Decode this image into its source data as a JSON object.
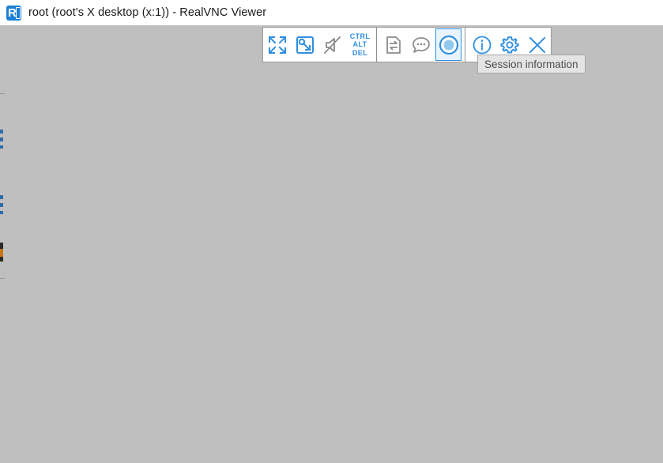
{
  "window": {
    "title": "root (root's X desktop (x:1)) - RealVNC Viewer",
    "app_icon": "realvnc-logo-icon",
    "titlebar_background": "#ffffff",
    "title_color": "#1a1a1a"
  },
  "desktop": {
    "background_color": "#bfbfbf",
    "description": "remote desktop canvas"
  },
  "toolbar": {
    "background": "#ffffff",
    "border_color": "#9b9b9b",
    "accent_color": "#2f8fe0",
    "disabled_color": "#8c8c8c",
    "active_highlight_background": "#eaf4fc",
    "buttons": [
      {
        "name": "fullscreen-button",
        "icon": "fullscreen-expand-icon",
        "state": "enabled",
        "color": "#2f8fe0"
      },
      {
        "name": "scaling-button",
        "icon": "scale-resize-icon",
        "state": "enabled",
        "color": "#2f8fe0"
      },
      {
        "name": "audio-mute-button",
        "icon": "speaker-muted-icon",
        "state": "disabled",
        "color": "#8c8c8c"
      },
      {
        "name": "ctrl-alt-del-button",
        "icon": "keyboard-shortcut-icon",
        "state": "enabled",
        "color": "#2f8fe0",
        "lines": [
          "CTRL",
          "ALT",
          "DEL"
        ]
      },
      {
        "name": "file-transfer-button",
        "icon": "file-transfer-icon",
        "state": "disabled",
        "color": "#8c8c8c"
      },
      {
        "name": "chat-button",
        "icon": "chat-bubble-icon",
        "state": "disabled",
        "color": "#8c8c8c"
      },
      {
        "name": "session-information-button",
        "icon": "session-record-circle-icon",
        "state": "active",
        "color": "#2f8fe0"
      },
      {
        "name": "info-button",
        "icon": "info-circle-icon",
        "state": "enabled",
        "color": "#2f8fe0"
      },
      {
        "name": "settings-button",
        "icon": "gear-icon",
        "state": "enabled",
        "color": "#2f8fe0"
      },
      {
        "name": "close-button",
        "icon": "close-x-icon",
        "state": "enabled",
        "color": "#2f8fe0"
      }
    ]
  },
  "tooltip": {
    "text": "Session information",
    "background": "#e4e4e4",
    "border_color": "#a6a6a6",
    "text_color": "#4d4d4d"
  }
}
